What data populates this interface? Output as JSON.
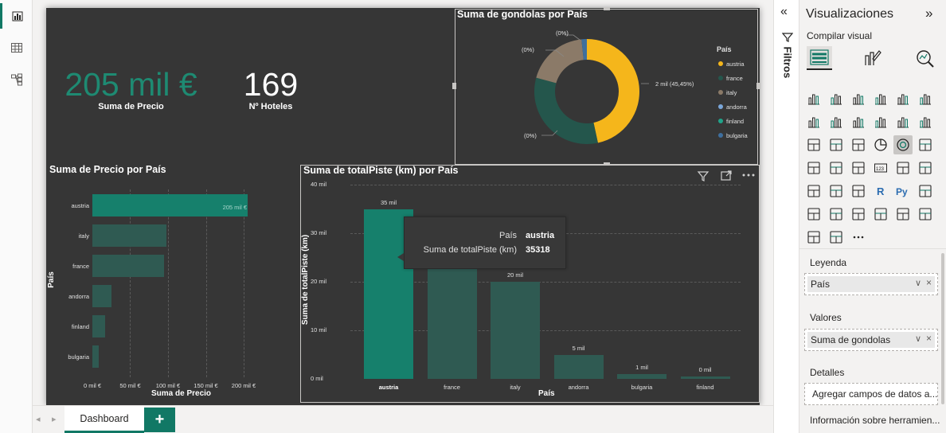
{
  "left_rail": {
    "icons": [
      "report-view-icon",
      "table-view-icon",
      "model-view-icon"
    ]
  },
  "kpis": {
    "precio": {
      "value": "205 mil €",
      "label": "Suma de Precio",
      "color": "#1e8a72"
    },
    "hoteles": {
      "value": "169",
      "label": "Nº Hoteles",
      "color": "#ffffff"
    }
  },
  "donut": {
    "title": "Suma de gondolas por País",
    "labels": [
      "(0%)",
      "(0%)",
      "2 mil (45,45%)",
      "(0%)"
    ],
    "legend_title": "País",
    "legend": [
      {
        "name": "austria",
        "color": "#f5b61b"
      },
      {
        "name": "france",
        "color": "#24564c"
      },
      {
        "name": "italy",
        "color": "#8b7a68"
      },
      {
        "name": "andorra",
        "color": "#7aa6d9"
      },
      {
        "name": "finland",
        "color": "#20a38a"
      },
      {
        "name": "bulgaria",
        "color": "#3e6f9e"
      }
    ]
  },
  "hbar": {
    "title": "Suma de Precio por País",
    "value_label": "205 mil €"
  },
  "vbar": {
    "title": "Suma de totalPiste (km) por País",
    "tooltip": {
      "key1": "País",
      "val1": "austria",
      "key2": "Suma de totalPiste (km)",
      "val2": "35318"
    }
  },
  "chart_data": [
    {
      "type": "pie",
      "title": "Suma de gondolas por País",
      "categories": [
        "austria",
        "france",
        "italy",
        "andorra",
        "finland",
        "bulgaria"
      ],
      "values": [
        2000,
        1400,
        820,
        0,
        0,
        70
      ]
    },
    {
      "type": "bar",
      "title": "Suma de Precio por País",
      "categories": [
        "austria",
        "italy",
        "france",
        "andorra",
        "finland",
        "bulgaria"
      ],
      "values": [
        205,
        98,
        95,
        25,
        17,
        8
      ],
      "xlabel": "Suma de Precio",
      "ylabel": "País",
      "xticks": [
        "0 mil €",
        "50 mil €",
        "100 mil €",
        "150 mil €",
        "200 mil €"
      ],
      "xlim": [
        0,
        200
      ]
    },
    {
      "type": "bar",
      "title": "Suma de totalPiste (km) por País",
      "categories": [
        "austria",
        "france",
        "italy",
        "andorra",
        "bulgaria",
        "finland"
      ],
      "values": [
        35,
        28,
        20,
        5,
        1,
        0.5
      ],
      "data_labels": [
        "35 mil",
        "",
        "20 mil",
        "5 mil",
        "1 mil",
        "0 mil"
      ],
      "xlabel": "País",
      "ylabel": "Suma de totalPiste (km)",
      "yticks": [
        "0 mil",
        "10 mil",
        "20 mil",
        "30 mil",
        "40 mil"
      ],
      "ylim": [
        0,
        40
      ]
    }
  ],
  "tabs": {
    "dashboard": "Dashboard",
    "add": "+"
  },
  "filters": {
    "label": "Filtros"
  },
  "viz_pane": {
    "title": "Visualizaciones",
    "build_label": "Compilar visual",
    "sections": {
      "legend": "Leyenda",
      "legend_value": "País",
      "values": "Valores",
      "values_value": "Suma de gondolas",
      "details": "Detalles",
      "details_placeholder": "Agregar campos de datos a...",
      "tooltips": "Información sobre herramien..."
    }
  }
}
